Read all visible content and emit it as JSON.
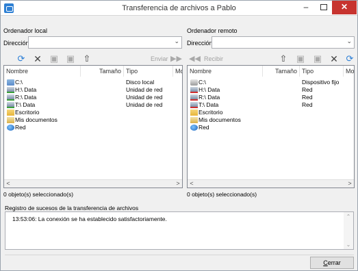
{
  "window": {
    "title": "Transferencia de archivos a Pablo",
    "minimize_glyph": "–",
    "close_glyph": "✕"
  },
  "local": {
    "label": "Ordenador local",
    "dir_label": "Dirección",
    "dir_value": "",
    "toolbar": {
      "refresh_icon": "refresh-icon",
      "delete_icon": "delete-icon",
      "send_label": "Enviar"
    },
    "columns": [
      "Nombre",
      "Tamaño",
      "Tipo",
      "Moc"
    ],
    "rows": [
      {
        "name": "C:\\",
        "type": "Disco local",
        "icon": "local-disk-icon"
      },
      {
        "name": "H:\\ Data",
        "type": "Unidad de red",
        "icon": "network-drive-icon"
      },
      {
        "name": "R:\\ Data",
        "type": "Unidad de red",
        "icon": "network-drive-icon"
      },
      {
        "name": "T:\\ Data",
        "type": "Unidad de red",
        "icon": "network-drive-icon"
      },
      {
        "name": "Escritorio",
        "type": "",
        "icon": "desktop-folder-icon"
      },
      {
        "name": "Mis documentos",
        "type": "",
        "icon": "documents-folder-icon"
      },
      {
        "name": "Red",
        "type": "",
        "icon": "network-globe-icon"
      }
    ],
    "status": "0 objeto(s) seleccionado(s)"
  },
  "remote": {
    "label": "Ordenador remoto",
    "dir_label": "Dirección",
    "dir_value": "",
    "toolbar": {
      "receive_label": "Recibir"
    },
    "columns": [
      "Nombre",
      "Tamaño",
      "Tipo",
      "Moc"
    ],
    "rows": [
      {
        "name": "C:\\",
        "type": "Dispositivo fijo",
        "icon": "fixed-disk-icon"
      },
      {
        "name": "H:\\ Data",
        "type": "Red",
        "icon": "network-drive-icon"
      },
      {
        "name": "R:\\ Data",
        "type": "Red",
        "icon": "network-drive-icon"
      },
      {
        "name": "T:\\ Data",
        "type": "Red",
        "icon": "network-drive-icon"
      },
      {
        "name": "Escritorio",
        "type": "",
        "icon": "desktop-folder-icon"
      },
      {
        "name": "Mis documentos",
        "type": "",
        "icon": "documents-folder-icon"
      },
      {
        "name": "Red",
        "type": "",
        "icon": "network-globe-icon"
      }
    ],
    "status": "0 objeto(s) seleccionado(s)"
  },
  "log": {
    "label": "Registro de sucesos de la transferencia de archivos",
    "entries": [
      "13:53:06: La conexión se ha establecido satisfactoriamente."
    ]
  },
  "buttons": {
    "close_first": "C",
    "close_rest": "errar"
  }
}
